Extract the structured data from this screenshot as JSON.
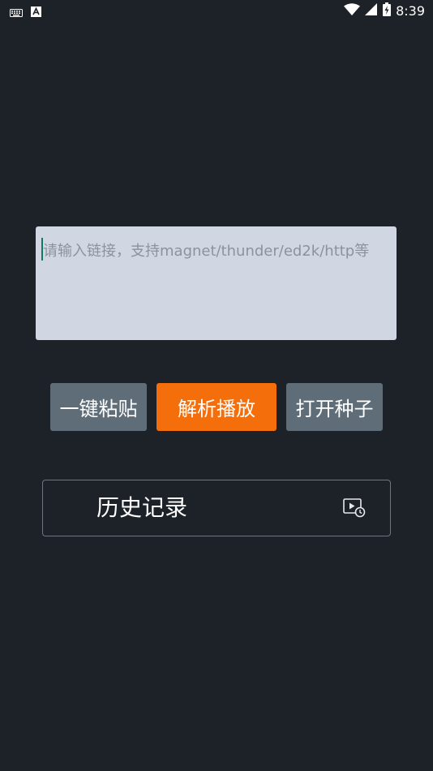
{
  "status_bar": {
    "time": "8:39",
    "left_icons": [
      "keyboard-icon",
      "text-a-icon"
    ],
    "right_icons": [
      "wifi-icon",
      "signal-icon",
      "battery-charging-icon"
    ]
  },
  "link_input": {
    "placeholder": "请输入链接，支持magnet/thunder/ed2k/http等",
    "value": ""
  },
  "buttons": {
    "paste": "一键粘贴",
    "parse": "解析播放",
    "open_torrent": "打开种子"
  },
  "history": {
    "label": "历史记录",
    "icon": "play-history-icon"
  },
  "colors": {
    "background": "#1d2128",
    "input_bg": "#d0d6e2",
    "button_gray": "#5f6d78",
    "button_orange": "#f46e0c",
    "caret": "#0f7b63"
  }
}
